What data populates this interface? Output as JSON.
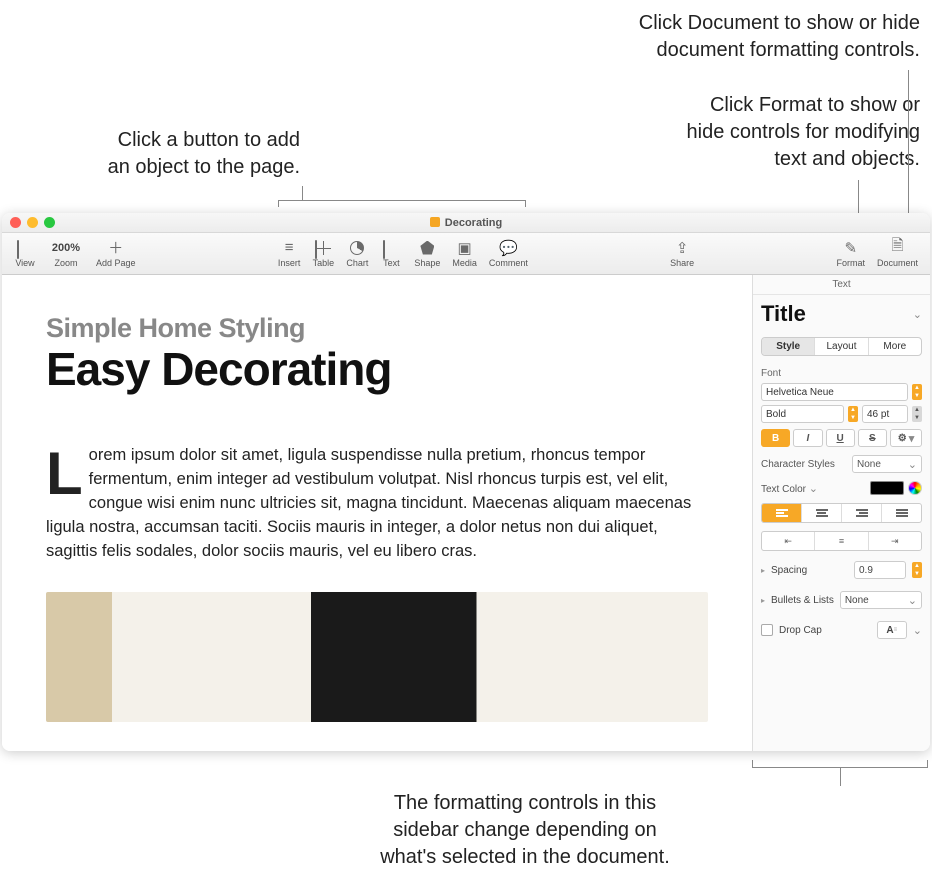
{
  "callouts": {
    "add_object": "Click a button to add\nan object to the page.",
    "document": "Click Document to show or hide\ndocument formatting controls.",
    "format": "Click Format to show or\nhide controls for modifying\ntext and objects.",
    "sidebar": "The formatting controls in this\nsidebar change depending on\nwhat's selected in the document."
  },
  "window": {
    "title": "Decorating"
  },
  "toolbar": {
    "view": "View",
    "zoom_label": "Zoom",
    "zoom_value": "200%",
    "add_page": "Add Page",
    "insert": "Insert",
    "table": "Table",
    "chart": "Chart",
    "text": "Text",
    "shape": "Shape",
    "media": "Media",
    "comment": "Comment",
    "share": "Share",
    "format": "Format",
    "document": "Document"
  },
  "document": {
    "subtitle": "Simple Home Styling",
    "title": "Easy Decorating",
    "body_dropcap": "L",
    "body": "orem ipsum dolor sit amet, ligula suspendisse nulla pretium, rhoncus tempor fermentum, enim integer ad vestibulum volutpat. Nisl rhoncus turpis est, vel elit, congue wisi enim nunc ultricies sit, magna tincidunt. Maecenas aliquam maecenas ligula nostra, accumsan taciti. Sociis mauris in integer, a dolor netus non dui aliquet, sagittis felis sodales, dolor sociis mauris, vel eu libero cras."
  },
  "sidebar": {
    "header": "Text",
    "paragraph_style": "Title",
    "tabs": {
      "style": "Style",
      "layout": "Layout",
      "more": "More"
    },
    "font_label": "Font",
    "font_family": "Helvetica Neue",
    "font_weight": "Bold",
    "font_size": "46 pt",
    "bold": "B",
    "italic": "I",
    "underline": "U",
    "strike": "S",
    "char_styles_label": "Character Styles",
    "char_styles_value": "None",
    "text_color_label": "Text Color",
    "spacing_label": "Spacing",
    "spacing_value": "0.9",
    "bullets_label": "Bullets & Lists",
    "bullets_value": "None",
    "dropcap_label": "Drop Cap",
    "dropcap_preview": "A"
  },
  "colors": {
    "accent": "#f7a826",
    "traffic_close": "#ff5f57",
    "traffic_min": "#febc2e",
    "traffic_max": "#28c840"
  }
}
